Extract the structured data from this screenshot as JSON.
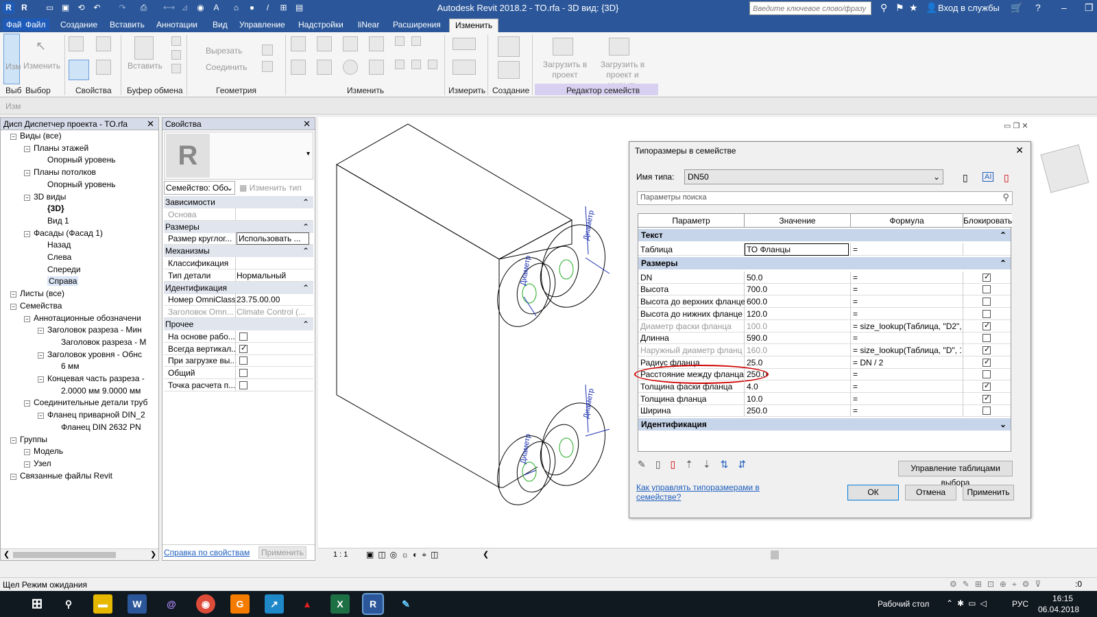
{
  "titlebar": {
    "app_title": "Autodesk Revit 2018.2 -   TO.rfa - 3D вид: {3D}",
    "search_placeholder": "Введите ключевое слово/фразу",
    "login": "Вход в службы"
  },
  "tabs": [
    "Фай",
    "Файл",
    "Создание",
    "Вставить",
    "Аннотации",
    "Вид",
    "Управление",
    "Надстройки",
    "liNear",
    "Расширения",
    "Изменить"
  ],
  "ribbon": {
    "panels": [
      "Выбор",
      "Свойства",
      "Буфер обмена",
      "Геометрия",
      "Изменить",
      "Измерить",
      "Создание",
      "Редактор семейств"
    ],
    "btn_modify": "Изменить",
    "btn_paste": "Вставить",
    "btn_cut": "Вырезать",
    "btn_join": "Соединить",
    "btn_load": "Загрузить в проект",
    "btn_load_close": "Загрузить в проект и закрыть",
    "left_stub": "Изм",
    "left_stub2": "Выб"
  },
  "subbar": "Изм",
  "browser": {
    "title": "Дисп Диспетчер проекта - TO.rfa",
    "items": [
      {
        "label": "Виды (все)",
        "indent": 0
      },
      {
        "label": "Планы этажей",
        "indent": 1
      },
      {
        "label": "Опорный уровень",
        "indent": 2
      },
      {
        "label": "Планы потолков",
        "indent": 1
      },
      {
        "label": "Опорный уровень",
        "indent": 2
      },
      {
        "label": "3D виды",
        "indent": 1
      },
      {
        "label": "{3D}",
        "indent": 2,
        "bold": true
      },
      {
        "label": "Вид 1",
        "indent": 2
      },
      {
        "label": "Фасады (Фасад 1)",
        "indent": 1
      },
      {
        "label": "Назад",
        "indent": 2
      },
      {
        "label": "Слева",
        "indent": 2
      },
      {
        "label": "Спереди",
        "indent": 2
      },
      {
        "label": "Справа",
        "indent": 2,
        "sel": true
      },
      {
        "label": "Листы (все)",
        "indent": 0
      },
      {
        "label": "Семейства",
        "indent": 0
      },
      {
        "label": "Аннотационные обозначени",
        "indent": 1
      },
      {
        "label": "Заголовок разреза - Мин",
        "indent": 2
      },
      {
        "label": "Заголовок разреза - М",
        "indent": 3
      },
      {
        "label": "Заголовок уровня - Обнс",
        "indent": 2
      },
      {
        "label": "6 мм",
        "indent": 3
      },
      {
        "label": "Концевая часть разреза -",
        "indent": 2
      },
      {
        "label": "2.0000 мм 9.0000 мм",
        "indent": 3
      },
      {
        "label": "Соединительные детали труб",
        "indent": 1
      },
      {
        "label": "Фланец приварной DIN_2",
        "indent": 2
      },
      {
        "label": "Фланец DIN 2632 PN",
        "indent": 3
      },
      {
        "label": "Группы",
        "indent": 0
      },
      {
        "label": "Модель",
        "indent": 1
      },
      {
        "label": "Узел",
        "indent": 1
      },
      {
        "label": "Связанные файлы Revit",
        "indent": 0
      }
    ]
  },
  "properties": {
    "title": "Свойства",
    "family_select": "Семейство: Обо",
    "edit_type": "Изменить тип",
    "rows": [
      {
        "g": "Зависимости"
      },
      {
        "k": "Основа",
        "v": "",
        "dim": true
      },
      {
        "g": "Размеры"
      },
      {
        "k": "Размер круглог...",
        "v": "Использовать ...",
        "box": true
      },
      {
        "g": "Механизмы"
      },
      {
        "k": "Классификация",
        "v": ""
      },
      {
        "k": "Тип детали",
        "v": "Нормальный"
      },
      {
        "g": "Идентификация"
      },
      {
        "k": "Номер OmniClass",
        "v": "23.75.00.00"
      },
      {
        "k": "Заголовок Omn...",
        "v": "Climate Control (...",
        "dim": true
      },
      {
        "g": "Прочее"
      },
      {
        "k": "На основе рабо...",
        "chk": false
      },
      {
        "k": "Всегда вертикал...",
        "chk": true
      },
      {
        "k": "При загрузке вы...",
        "chk": false
      },
      {
        "k": "Общий",
        "chk": false
      },
      {
        "k": "Точка расчета п...",
        "chk": false
      }
    ],
    "help_link": "Справка по свойствам",
    "apply": "Применить"
  },
  "view": {
    "scale": "1 : 1",
    "dim_label": "Диаметр"
  },
  "dialog": {
    "title": "Типоразмеры в семействе",
    "type_name_label": "Имя типа:",
    "type_name": "DN50",
    "search_placeholder": "Параметры поиска",
    "headers": [
      "Параметр",
      "Значение",
      "Формула",
      "Блокировать"
    ],
    "groups": [
      {
        "name": "Текст",
        "rows": [
          {
            "p": "Таблица",
            "v": "ТО Фланцы",
            "f": "=",
            "edit": true
          }
        ]
      },
      {
        "name": "Размеры",
        "rows": [
          {
            "p": "DN",
            "v": "50.0",
            "f": "=",
            "lock": true
          },
          {
            "p": "Высота",
            "v": "700.0",
            "f": "=",
            "lock": false
          },
          {
            "p": "Высота до верхних фланце",
            "v": "600.0",
            "f": "=",
            "lock": false
          },
          {
            "p": "Высота до нижних фланце",
            "v": "120.0",
            "f": "=",
            "lock": false
          },
          {
            "p": "Диаметр фаски фланца",
            "v": "100.0",
            "f": "= size_lookup(Таблица, \"D2\",",
            "lock": true,
            "dim": true
          },
          {
            "p": "Длинна",
            "v": "590.0",
            "f": "=",
            "lock": false
          },
          {
            "p": "Наружный диаметр фланц",
            "v": "160.0",
            "f": "= size_lookup(Таблица, \"D\", 1",
            "lock": true,
            "dim": true
          },
          {
            "p": "Радиус фланца",
            "v": "25.0",
            "f": "= DN / 2",
            "lock": true
          },
          {
            "p": "Расстояние между фланца",
            "v": "250.0",
            "f": "=",
            "lock": false,
            "hl": true
          },
          {
            "p": "Толщина фаски фланца",
            "v": "4.0",
            "f": "=",
            "lock": true
          },
          {
            "p": "Толщина фланца",
            "v": "10.0",
            "f": "=",
            "lock": true
          },
          {
            "p": "Ширина",
            "v": "250.0",
            "f": "=",
            "lock": false
          }
        ]
      },
      {
        "name": "Идентификация",
        "rows": []
      }
    ],
    "manage_btn": "Управление таблицами выбора",
    "help_link": "Как управлять типоразмерами в семействе?",
    "ok": "ОК",
    "cancel": "Отмена",
    "apply": "Применить"
  },
  "status": "Щел Режим ожидания",
  "taskbar": {
    "desktop": "Рабочий стол",
    "lang": "РУС",
    "time": "16:15",
    "date": "06.04.2018"
  },
  "colors": {
    "title_blue": "#2b579a",
    "highlight_red": "#d00000",
    "group_blue": "#c7d5ea"
  }
}
